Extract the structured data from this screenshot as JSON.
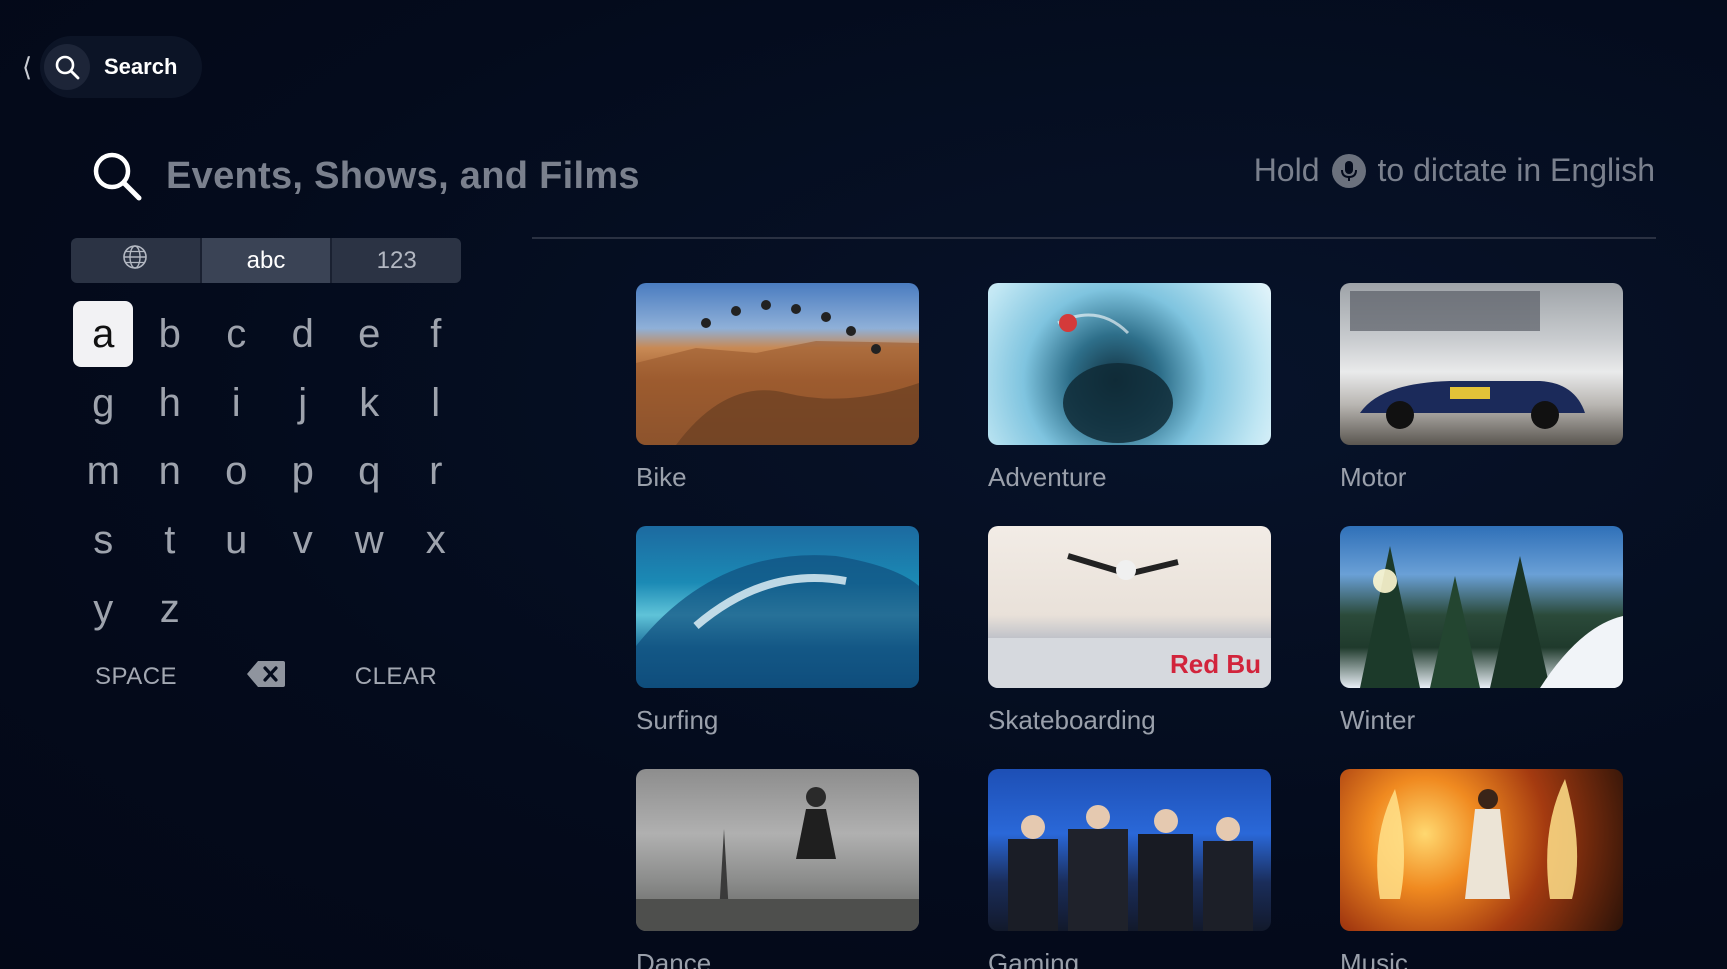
{
  "nav": {
    "title": "Search"
  },
  "search": {
    "placeholder": "Events, Shows, and Films",
    "dictate_prefix": "Hold",
    "dictate_suffix": "to dictate in English"
  },
  "keyboard": {
    "tabs": [
      "abc",
      "123"
    ],
    "active_tab": "abc",
    "selected_key": "a",
    "keys": [
      "a",
      "b",
      "c",
      "d",
      "e",
      "f",
      "g",
      "h",
      "i",
      "j",
      "k",
      "l",
      "m",
      "n",
      "o",
      "p",
      "q",
      "r",
      "s",
      "t",
      "u",
      "v",
      "w",
      "x",
      "y",
      "z"
    ],
    "space_label": "SPACE",
    "clear_label": "CLEAR"
  },
  "categories": [
    {
      "label": "Bike"
    },
    {
      "label": "Adventure"
    },
    {
      "label": "Motor"
    },
    {
      "label": "Surfing"
    },
    {
      "label": "Skateboarding"
    },
    {
      "label": "Winter"
    },
    {
      "label": "Dance"
    },
    {
      "label": "Gaming"
    },
    {
      "label": "Music"
    }
  ],
  "colors": {
    "background": "#040b1c",
    "selected_key": "#f2f2f4",
    "muted_text": "#7a808d"
  }
}
